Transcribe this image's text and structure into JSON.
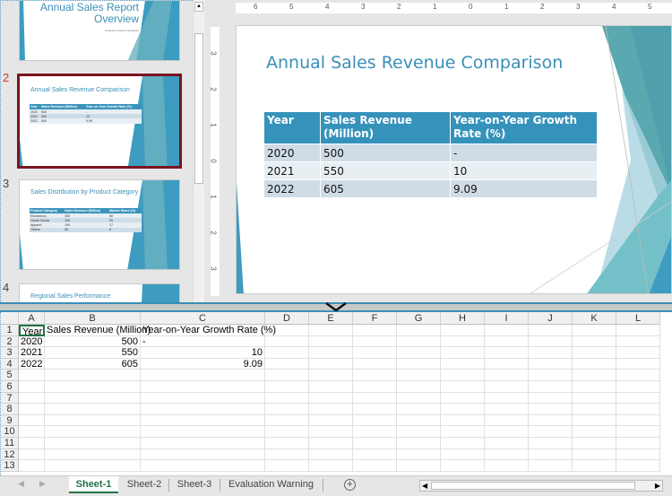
{
  "thumbnails": [
    {
      "number": "1",
      "title": "Annual Sales Report Overview",
      "title_line1": "Annual Sales Report",
      "title_line2": "Overview",
      "subtitle": "Analysis & Future Strategies"
    },
    {
      "number": "2",
      "title": "Annual Sales Revenue Comparison",
      "headers": [
        "Year",
        "Sales Revenue (Million)",
        "Year-on-Year Growth Rate (%)"
      ],
      "rows": [
        [
          "2020",
          "500",
          "-"
        ],
        [
          "2021",
          "550",
          "10"
        ],
        [
          "2022",
          "605",
          "9.09"
        ]
      ]
    },
    {
      "number": "3",
      "title": "Sales Distribution by Product Category",
      "headers": [
        "Product Category",
        "Sales Revenue (Million)",
        "Market Share (%)"
      ],
      "rows": [
        [
          "Electronics",
          "300",
          "50"
        ],
        [
          "Home Goods",
          "150",
          "25"
        ],
        [
          "Apparel",
          "100",
          "17"
        ],
        [
          "Others",
          "55",
          "8"
        ]
      ]
    },
    {
      "number": "4",
      "title": "Regional Sales Performance"
    }
  ],
  "ruler": {
    "horizontal": [
      "6",
      "5",
      "4",
      "3",
      "2",
      "1",
      "0",
      "1",
      "2",
      "3",
      "4",
      "5"
    ],
    "vertical": [
      "3",
      "2",
      "1",
      "0",
      "1",
      "2",
      "3"
    ]
  },
  "slide": {
    "title": "Annual Sales Revenue Comparison",
    "headers": [
      "Year",
      "Sales Revenue (Million)",
      "Year-on-Year Growth Rate (%)"
    ],
    "rows": [
      [
        "2020",
        "500",
        "-"
      ],
      [
        "2021",
        "550",
        "10"
      ],
      [
        "2022",
        "605",
        "9.09"
      ]
    ]
  },
  "sheet": {
    "columns": [
      "A",
      "B",
      "C",
      "D",
      "E",
      "F",
      "G",
      "H",
      "I",
      "J",
      "K",
      "L"
    ],
    "rows": [
      "1",
      "2",
      "3",
      "4",
      "5",
      "6",
      "7",
      "8",
      "9",
      "10",
      "11",
      "12",
      "13"
    ],
    "cells": [
      [
        "Year",
        "Sales Revenue (Million)",
        "Year-on-Year Growth Rate (%)"
      ],
      [
        "2020",
        "500",
        "-"
      ],
      [
        "2021",
        "550",
        "10"
      ],
      [
        "2022",
        "605",
        "9.09"
      ]
    ],
    "tabs": [
      "Sheet-1",
      "Sheet-2",
      "Sheet-3",
      "Evaluation Warning"
    ],
    "active_tab": "Sheet-1",
    "add_sheet": "+"
  },
  "colors": {
    "accent": "#3592bb",
    "selected_thumb": "#7a1520",
    "excel_green": "#217346"
  }
}
